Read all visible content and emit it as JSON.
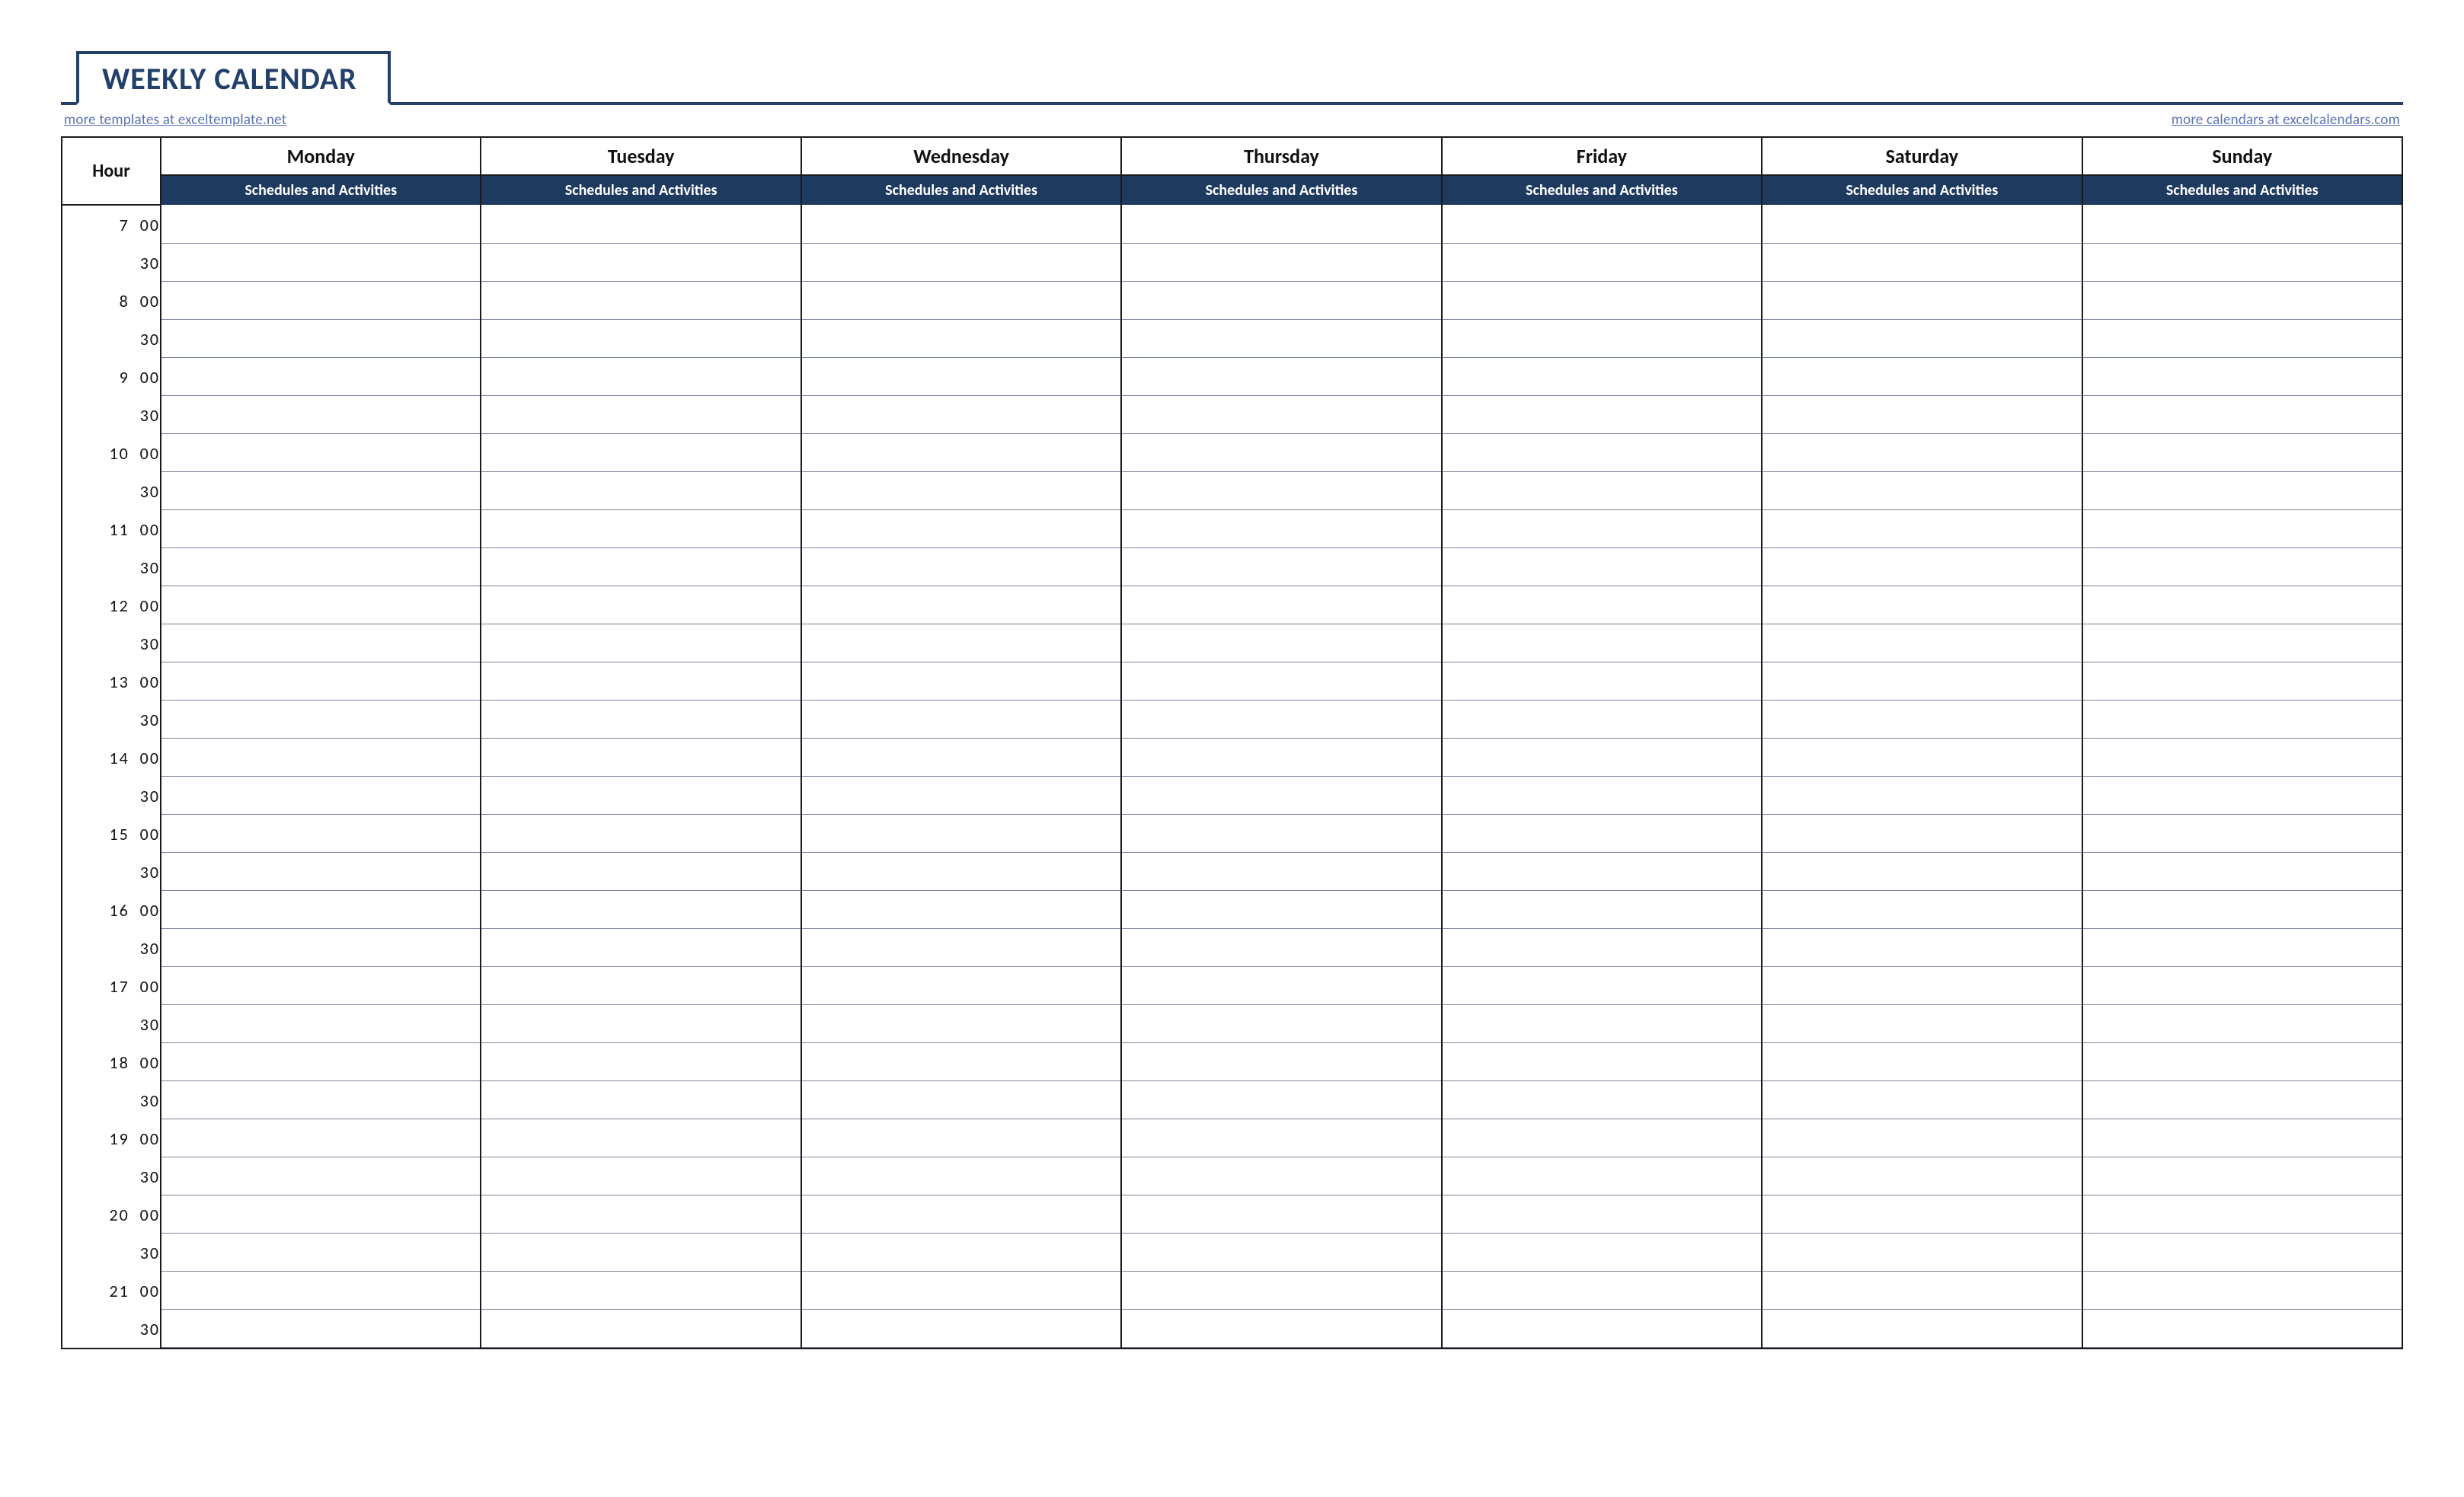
{
  "title": "WEEKLY CALENDAR",
  "link_left": "more templates at exceltemplate.net",
  "link_right": "more calendars at excelcalendars.com",
  "hour_header": "Hour",
  "sub_header": "Schedules and Activities",
  "days": [
    "Monday",
    "Tuesday",
    "Wednesday",
    "Thursday",
    "Friday",
    "Saturday",
    "Sunday"
  ],
  "time_slots": [
    "7  00",
    "30",
    "8  00",
    "30",
    "9  00",
    "30",
    "10  00",
    "30",
    "11  00",
    "30",
    "12  00",
    "30",
    "13  00",
    "30",
    "14  00",
    "30",
    "15  00",
    "30",
    "16  00",
    "30",
    "17  00",
    "30",
    "18  00",
    "30",
    "19  00",
    "30",
    "20  00",
    "30",
    "21  00",
    "30"
  ]
}
